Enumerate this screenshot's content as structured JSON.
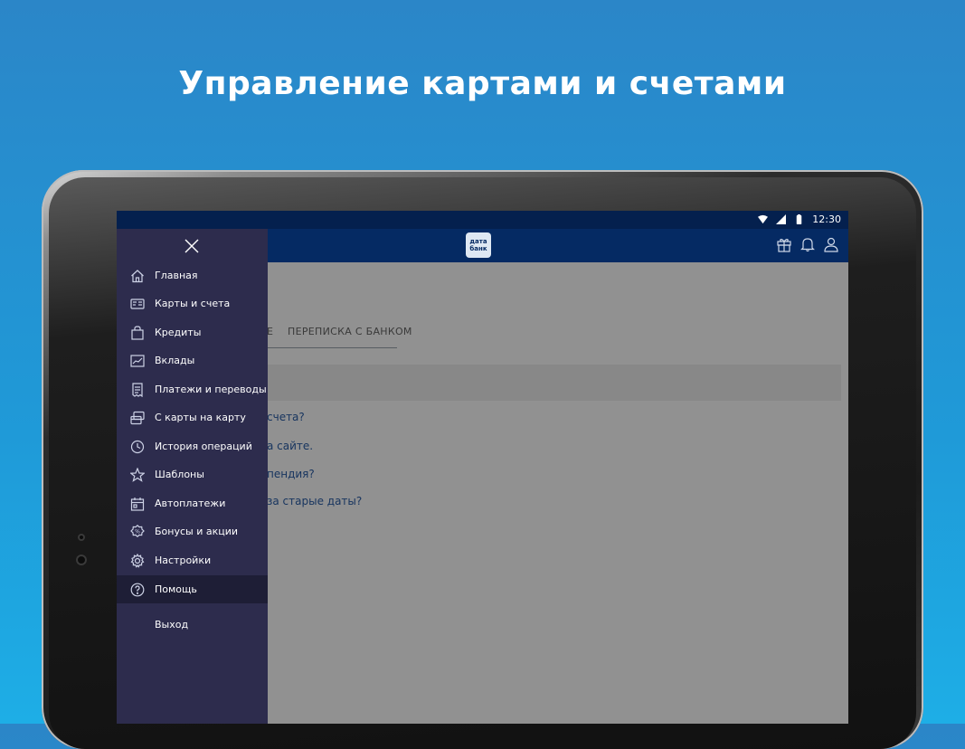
{
  "headline": "Управление картами и счетами",
  "status": {
    "time": "12:30",
    "icons": [
      "wifi-icon",
      "signal-icon",
      "battery-icon"
    ]
  },
  "appbar": {
    "logo_top": "дата",
    "logo_bottom": "банк",
    "actions": [
      "gift-icon",
      "bell-icon",
      "profile-icon"
    ]
  },
  "content": {
    "tabs": [
      {
        "label": "Е"
      },
      {
        "label": "ПЕРЕПИСКА С БАНКОМ"
      }
    ],
    "faq": [
      "счета?",
      "а сайте.",
      "пендия?",
      "за старые даты?"
    ]
  },
  "drawer": {
    "items": [
      {
        "label": "Главная",
        "icon": "home-icon"
      },
      {
        "label": "Карты и счета",
        "icon": "cards-icon"
      },
      {
        "label": "Кредиты",
        "icon": "bag-icon"
      },
      {
        "label": "Вклады",
        "icon": "chart-icon"
      },
      {
        "label": "Платежи и переводы",
        "icon": "receipt-icon"
      },
      {
        "label": "С карты на карту",
        "icon": "card-transfer-icon"
      },
      {
        "label": "История операций",
        "icon": "clock-icon"
      },
      {
        "label": "Шаблоны",
        "icon": "star-icon"
      },
      {
        "label": "Автоплатежи",
        "icon": "calendar-icon"
      },
      {
        "label": "Бонусы и акции",
        "icon": "badge-icon"
      },
      {
        "label": "Настройки",
        "icon": "gear-icon"
      },
      {
        "label": "Помощь",
        "icon": "help-icon",
        "active": true
      },
      {
        "label": "Выход",
        "icon": ""
      }
    ]
  },
  "colors": {
    "background": "#1f9ad8",
    "appbar": "#052a63",
    "drawer": "#2d2c4d",
    "drawer_active": "#1e1e36",
    "link": "#2b5ea8"
  }
}
